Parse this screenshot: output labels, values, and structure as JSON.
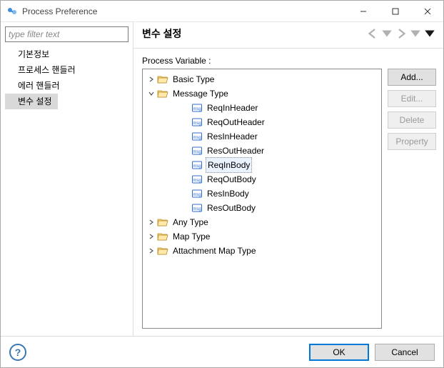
{
  "window": {
    "title": "Process Preference"
  },
  "filter": {
    "placeholder": "type filter text"
  },
  "nav": {
    "items": [
      {
        "label": "기본정보"
      },
      {
        "label": "프로세스 핸들러"
      },
      {
        "label": "에러 핸들러"
      },
      {
        "label": "변수 설정"
      }
    ],
    "selected": 3
  },
  "pane": {
    "title": "변수 설정"
  },
  "pv": {
    "label": "Process Variable :",
    "tree": [
      {
        "level": 0,
        "icon": "folder",
        "expandable": true,
        "expanded": false,
        "label": "Basic Type"
      },
      {
        "level": 0,
        "icon": "folder",
        "expandable": true,
        "expanded": true,
        "label": "Message Type"
      },
      {
        "level": 1,
        "icon": "msg",
        "label": "ReqInHeader"
      },
      {
        "level": 1,
        "icon": "msg",
        "label": "ReqOutHeader"
      },
      {
        "level": 1,
        "icon": "msg",
        "label": "ResInHeader"
      },
      {
        "level": 1,
        "icon": "msg",
        "label": "ResOutHeader"
      },
      {
        "level": 1,
        "icon": "msg",
        "label": "ReqInBody",
        "selected": true
      },
      {
        "level": 1,
        "icon": "msg",
        "label": "ReqOutBody"
      },
      {
        "level": 1,
        "icon": "msg",
        "label": "ResInBody"
      },
      {
        "level": 1,
        "icon": "msg",
        "label": "ResOutBody"
      },
      {
        "level": 0,
        "icon": "folder",
        "expandable": true,
        "expanded": false,
        "label": "Any Type"
      },
      {
        "level": 0,
        "icon": "folder",
        "expandable": true,
        "expanded": false,
        "label": "Map Type"
      },
      {
        "level": 0,
        "icon": "folder",
        "expandable": true,
        "expanded": false,
        "label": "Attachment Map Type"
      }
    ]
  },
  "buttons": {
    "add": {
      "label": "Add...",
      "enabled": true
    },
    "edit": {
      "label": "Edit...",
      "enabled": false
    },
    "delete": {
      "label": "Delete",
      "enabled": false
    },
    "property": {
      "label": "Property",
      "enabled": false
    }
  },
  "footer": {
    "ok": "OK",
    "cancel": "Cancel"
  }
}
